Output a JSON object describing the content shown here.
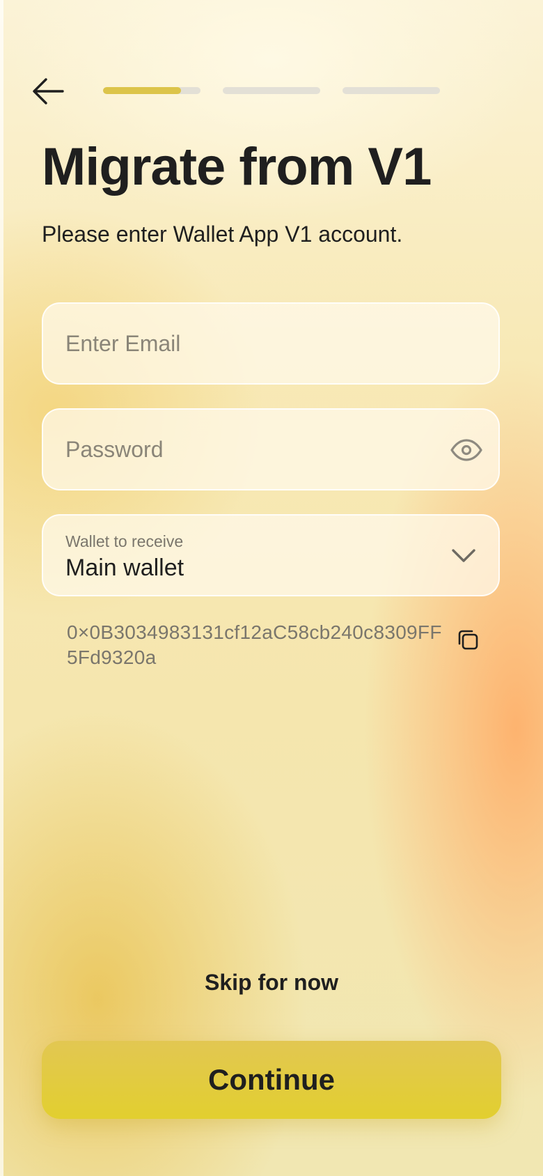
{
  "header": {
    "back_icon": "arrow-left-icon",
    "steps": [
      {
        "progress": 0.8
      },
      {
        "progress": 0
      },
      {
        "progress": 0
      }
    ],
    "progress_color": "#dcc44a",
    "track_color": "#e3e0d6"
  },
  "main": {
    "title": "Migrate from V1",
    "subtitle": "Please enter Wallet App V1 account.",
    "email": {
      "placeholder": "Enter Email",
      "value": ""
    },
    "password": {
      "placeholder": "Password",
      "value": "",
      "toggle_icon": "eye-icon"
    },
    "wallet": {
      "label": "Wallet to receive",
      "value": "Main wallet",
      "icon": "chevron-down-icon"
    },
    "address": "0×0B3034983131cf12aC58cb240c8309FF5Fd9320a",
    "copy_icon": "copy-icon"
  },
  "footer": {
    "skip_label": "Skip for now",
    "continue_label": "Continue",
    "accent": "#e2cf2f"
  }
}
